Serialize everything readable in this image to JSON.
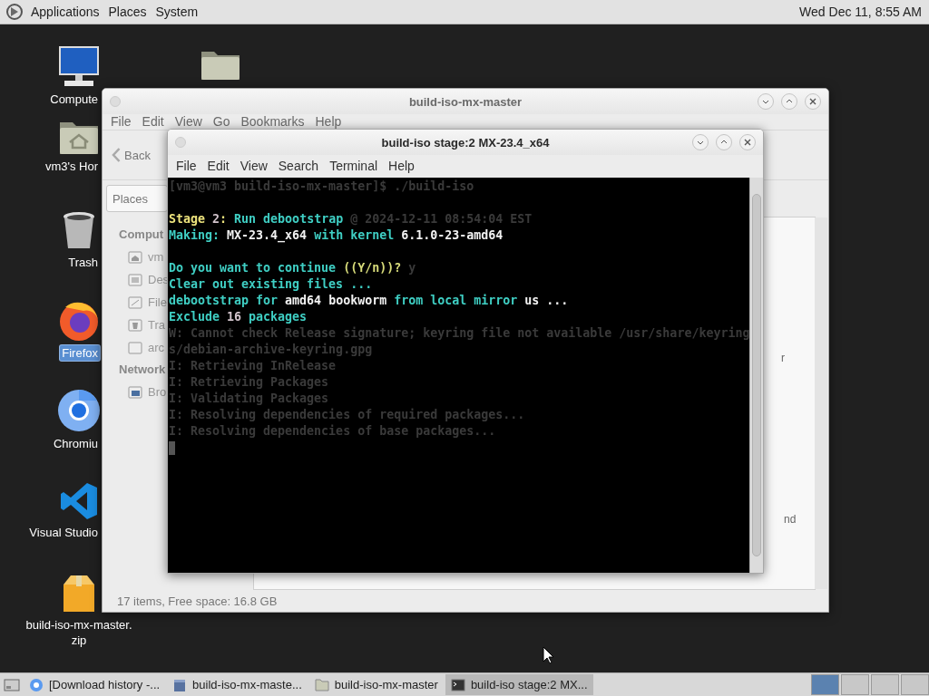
{
  "top_panel": {
    "menus": [
      "Applications",
      "Places",
      "System"
    ],
    "clock": "Wed Dec 11, 8:55 AM"
  },
  "desktop_icons": [
    {
      "kind": "computer",
      "lines": [
        "Compute"
      ],
      "selected": false
    },
    {
      "kind": "folder"
    },
    {
      "kind": "home",
      "lines": [
        "vm3's Hor"
      ],
      "selected": false
    },
    {
      "kind": "trash",
      "lines": [
        "Trash"
      ],
      "selected": false
    },
    {
      "kind": "firefox",
      "lines": [
        "Firefox"
      ],
      "selected": true
    },
    {
      "kind": "chromium",
      "lines": [
        "Chromiu"
      ],
      "selected": false
    },
    {
      "kind": "vscode",
      "lines": [
        "Visual Studio"
      ],
      "selected": false
    },
    {
      "kind": "archive",
      "lines": [
        "build-iso-mx-master.",
        "zip"
      ],
      "selected": false
    }
  ],
  "file_manager": {
    "title": "build-iso-mx-master",
    "menu": [
      "File",
      "Edit",
      "View",
      "Go",
      "Bookmarks",
      "Help"
    ],
    "back": "Back",
    "location": "Places",
    "sidebar": [
      {
        "heading": "Comput",
        "items": [
          {
            "kind": "home",
            "label": "vm"
          },
          {
            "kind": "desktop",
            "label": "Des"
          },
          {
            "kind": "filesystem",
            "label": "File"
          },
          {
            "kind": "trash",
            "label": "Tra"
          },
          {
            "kind": "drive",
            "label": "arc"
          }
        ]
      },
      {
        "heading": "Network",
        "items": [
          {
            "kind": "network",
            "label": "Bro"
          }
        ]
      }
    ],
    "content_fragments": [
      "r",
      "nd"
    ],
    "status": "17 items, Free space: 16.8 GB"
  },
  "terminal": {
    "title": "build-iso stage:2 MX-23.4_x64",
    "menu": [
      "File",
      "Edit",
      "View",
      "Search",
      "Terminal",
      "Help"
    ],
    "lines": [
      {
        "segments": [
          {
            "text": "[vm3@vm3 build-iso-mx-master]$ ./build-iso",
            "color": "#3a3a3a"
          }
        ]
      },
      {
        "kind": "blank"
      },
      {
        "segments": [
          {
            "text": "Stage ",
            "color": "#ece27c"
          },
          {
            "text": "2",
            "color": "#d2c4cc"
          },
          {
            "text": ": ",
            "color": "#ece27c"
          },
          {
            "text": "Run debootstrap ",
            "color": "#3fcfc4"
          },
          {
            "text": "@ 2024-12-11 08:54:04 EST",
            "color": "#3a3a3a"
          }
        ]
      },
      {
        "segments": [
          {
            "text": "Making: ",
            "color": "#3fcfc4"
          },
          {
            "text": "MX-23.4_x64 ",
            "color": "#f2f2f2"
          },
          {
            "text": "with kernel ",
            "color": "#3fcfc4"
          },
          {
            "text": "6.1.0-23-amd64",
            "color": "#f2f2f2"
          }
        ]
      },
      {
        "kind": "blank"
      },
      {
        "segments": [
          {
            "text": "Do you want to continue ",
            "color": "#3fcfc4"
          },
          {
            "text": "((Y/n))?",
            "color": "#d8dc7a"
          },
          {
            "text": " y",
            "color": "#3a3a3a"
          }
        ]
      },
      {
        "segments": [
          {
            "text": "Clear out existing files ...",
            "color": "#3fcfc4"
          }
        ]
      },
      {
        "segments": [
          {
            "text": "debootstrap for ",
            "color": "#3fcfc4"
          },
          {
            "text": "amd64 bookworm ",
            "color": "#f2f2f2"
          },
          {
            "text": "from local mirror ",
            "color": "#3fcfc4"
          },
          {
            "text": "us ...",
            "color": "#f2f2f2"
          }
        ]
      },
      {
        "segments": [
          {
            "text": "Exclude ",
            "color": "#3fcfc4"
          },
          {
            "text": "16 ",
            "color": "#d2c4cc"
          },
          {
            "text": "packages",
            "color": "#3fcfc4"
          }
        ]
      },
      {
        "segments": [
          {
            "text": "W: Cannot check Release signature; keyring file not available /usr/share/keyring",
            "color": "#3a3a3a"
          }
        ]
      },
      {
        "segments": [
          {
            "text": "s/debian-archive-keyring.gpg",
            "color": "#3a3a3a"
          }
        ]
      },
      {
        "segments": [
          {
            "text": "I: Retrieving InRelease",
            "color": "#3a3a3a"
          }
        ]
      },
      {
        "segments": [
          {
            "text": "I: Retrieving Packages",
            "color": "#3a3a3a"
          }
        ]
      },
      {
        "segments": [
          {
            "text": "I: Validating Packages",
            "color": "#3a3a3a"
          }
        ]
      },
      {
        "segments": [
          {
            "text": "I: Resolving dependencies of required packages...",
            "color": "#3a3a3a"
          }
        ]
      },
      {
        "segments": [
          {
            "text": "I: Resolving dependencies of base packages...",
            "color": "#3a3a3a"
          }
        ]
      },
      {
        "kind": "cursor"
      }
    ]
  },
  "taskbar": {
    "tasks": [
      {
        "kind": "browser",
        "label": "[Download history -...",
        "selected": false
      },
      {
        "kind": "archive",
        "label": "build-iso-mx-maste...",
        "selected": false
      },
      {
        "kind": "folder",
        "label": "build-iso-mx-master",
        "selected": false
      },
      {
        "kind": "terminal",
        "label": "build-iso stage:2 MX...",
        "selected": true
      }
    ],
    "workspaces": [
      {
        "selected": true
      },
      {
        "selected": false
      },
      {
        "selected": false
      },
      {
        "selected": false
      }
    ]
  }
}
